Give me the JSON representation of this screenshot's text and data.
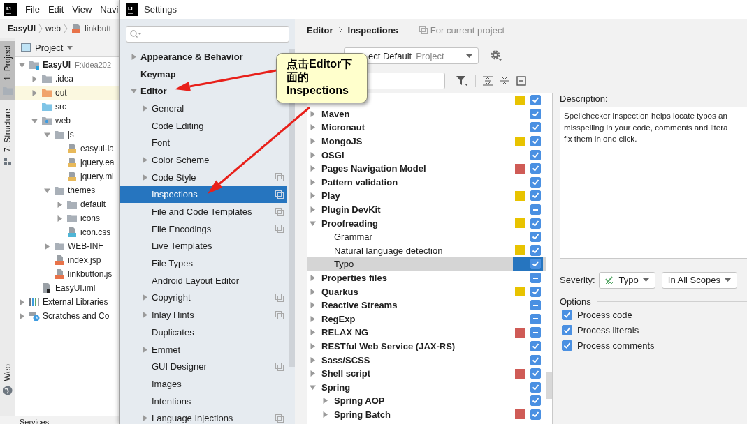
{
  "ide": {
    "logo_text": "IJ",
    "menu": [
      "File",
      "Edit",
      "View",
      "Navi"
    ],
    "breadcrumb": [
      {
        "label": "EasyUI",
        "kind": "project"
      },
      {
        "label": "web",
        "kind": "folder"
      },
      {
        "label": "linkbutt",
        "kind": "jsp"
      }
    ],
    "tool_strip": [
      {
        "label": "1: Project",
        "kind": "folder",
        "selected": true
      },
      {
        "label": "7: Structure",
        "kind": "structure",
        "selected": false
      }
    ],
    "tool_strip_bottom": [
      {
        "label": "Web",
        "kind": "globe"
      }
    ],
    "project_panel": {
      "title": "Project",
      "tree": [
        {
          "label": "EasyUI",
          "note": "F:\\idea202",
          "kind": "module",
          "expanded": true,
          "selected": false,
          "children": [
            {
              "label": ".idea",
              "kind": "folder",
              "expanded": false,
              "selected": false
            },
            {
              "label": "out",
              "kind": "excluded",
              "expanded": false,
              "selected": true
            },
            {
              "label": "src",
              "kind": "source",
              "selected": false
            },
            {
              "label": "web",
              "kind": "web",
              "expanded": true,
              "selected": false,
              "children": [
                {
                  "label": "js",
                  "kind": "folder",
                  "expanded": true,
                  "selected": false,
                  "children": [
                    {
                      "label": "easyui-la",
                      "kind": "js",
                      "selected": false
                    },
                    {
                      "label": "jquery.ea",
                      "kind": "minjs",
                      "selected": false
                    },
                    {
                      "label": "jquery.mi",
                      "kind": "minjs",
                      "selected": false
                    }
                  ]
                },
                {
                  "label": "themes",
                  "kind": "folder",
                  "expanded": true,
                  "selected": false,
                  "children": [
                    {
                      "label": "default",
                      "kind": "folder",
                      "expanded": false,
                      "selected": false
                    },
                    {
                      "label": "icons",
                      "kind": "folder",
                      "expanded": false,
                      "selected": false
                    },
                    {
                      "label": "icon.css",
                      "kind": "css",
                      "selected": false
                    }
                  ]
                },
                {
                  "label": "WEB-INF",
                  "kind": "folder",
                  "expanded": false,
                  "selected": false
                },
                {
                  "label": "index.jsp",
                  "kind": "jsp",
                  "selected": false
                },
                {
                  "label": "linkbutton.js",
                  "kind": "jsp",
                  "selected": false
                }
              ]
            },
            {
              "label": "EasyUI.iml",
              "kind": "iml",
              "selected": false
            }
          ]
        },
        {
          "label": "External Libraries",
          "kind": "libs",
          "expanded": false,
          "selected": false
        },
        {
          "label": "Scratches and Co",
          "kind": "scratches",
          "expanded": false,
          "selected": false
        }
      ]
    },
    "bottom_tab": "Services"
  },
  "settings": {
    "logo_text": "IJ",
    "title": "Settings",
    "nav": [
      {
        "label": "Appearance & Behavior",
        "expanded": false,
        "selected": false,
        "project_scope": false
      },
      {
        "label": "Keymap",
        "selected": false,
        "project_scope": false
      },
      {
        "label": "Editor",
        "expanded": true,
        "selected": false,
        "project_scope": false,
        "children": [
          {
            "label": "General",
            "expanded": false,
            "selected": false,
            "project_scope": false
          },
          {
            "label": "Code Editing",
            "selected": false,
            "project_scope": false
          },
          {
            "label": "Font",
            "selected": false,
            "project_scope": false
          },
          {
            "label": "Color Scheme",
            "expanded": false,
            "selected": false,
            "project_scope": false
          },
          {
            "label": "Code Style",
            "expanded": false,
            "selected": false,
            "project_scope": true
          },
          {
            "label": "Inspections",
            "selected": true,
            "project_scope": true
          },
          {
            "label": "File and Code Templates",
            "selected": false,
            "project_scope": true
          },
          {
            "label": "File Encodings",
            "selected": false,
            "project_scope": true
          },
          {
            "label": "Live Templates",
            "selected": false,
            "project_scope": false
          },
          {
            "label": "File Types",
            "selected": false,
            "project_scope": false
          },
          {
            "label": "Android Layout Editor",
            "selected": false,
            "project_scope": false
          },
          {
            "label": "Copyright",
            "expanded": false,
            "selected": false,
            "project_scope": true
          },
          {
            "label": "Inlay Hints",
            "expanded": false,
            "selected": false,
            "project_scope": true
          },
          {
            "label": "Duplicates",
            "selected": false,
            "project_scope": false
          },
          {
            "label": "Emmet",
            "expanded": false,
            "selected": false,
            "project_scope": false
          },
          {
            "label": "GUI Designer",
            "selected": false,
            "project_scope": true
          },
          {
            "label": "Images",
            "selected": false,
            "project_scope": false
          },
          {
            "label": "Intentions",
            "selected": false,
            "project_scope": false
          },
          {
            "label": "Language Injections",
            "expanded": false,
            "selected": false,
            "project_scope": true
          }
        ]
      }
    ],
    "breadcrumb": [
      "Editor",
      "Inspections"
    ],
    "scope_note": "For current project",
    "profile": {
      "value": "ect Default",
      "scope": "Project"
    },
    "inspections": [
      {
        "color": "#e8c300",
        "checked": true,
        "selected": false
      },
      {
        "name": "Maven",
        "expanded": false,
        "checked": true,
        "selected": false
      },
      {
        "name": "Micronaut",
        "expanded": false,
        "checked": true,
        "selected": false
      },
      {
        "name": "MongoJS",
        "expanded": false,
        "color": "#e8c300",
        "checked": true,
        "selected": false
      },
      {
        "name": "OSGi",
        "expanded": false,
        "checked": true,
        "selected": false
      },
      {
        "name": "Pages Navigation Model",
        "expanded": false,
        "color": "#cf5b56",
        "checked": true,
        "selected": false
      },
      {
        "name": "Pattern validation",
        "expanded": false,
        "checked": true,
        "selected": false
      },
      {
        "name": "Play",
        "expanded": false,
        "color": "#e8c300",
        "checked": true,
        "selected": false
      },
      {
        "name": "Plugin DevKit",
        "expanded": false,
        "partial": true,
        "selected": false
      },
      {
        "name": "Proofreading",
        "expanded": true,
        "color": "#e8c300",
        "checked": true,
        "selected": false,
        "children": [
          {
            "name": "Grammar",
            "checked": true,
            "selected": false
          },
          {
            "name": "Natural language detection",
            "color": "#e8c300",
            "checked": true,
            "selected": false
          },
          {
            "name": "Typo",
            "checked": true,
            "selected": true
          }
        ]
      },
      {
        "name": "Properties files",
        "expanded": false,
        "partial": true,
        "selected": false
      },
      {
        "name": "Quarkus",
        "expanded": false,
        "color": "#e8c300",
        "checked": true,
        "selected": false
      },
      {
        "name": "Reactive Streams",
        "expanded": false,
        "partial": true,
        "selected": false
      },
      {
        "name": "RegExp",
        "expanded": false,
        "partial": true,
        "selected": false
      },
      {
        "name": "RELAX NG",
        "expanded": false,
        "color": "#cf5b56",
        "partial": true,
        "selected": false
      },
      {
        "name": "RESTful Web Service (JAX-RS)",
        "expanded": false,
        "checked": true,
        "selected": false
      },
      {
        "name": "Sass/SCSS",
        "expanded": false,
        "checked": true,
        "selected": false
      },
      {
        "name": "Shell script",
        "expanded": false,
        "color": "#cf5b56",
        "checked": true,
        "selected": false
      },
      {
        "name": "Spring",
        "expanded": true,
        "checked": true,
        "selected": false,
        "children": [
          {
            "name": "Spring AOP",
            "expanded": false,
            "checked": true,
            "selected": false
          },
          {
            "name": "Spring Batch",
            "expanded": false,
            "color": "#cf5b56",
            "checked": true,
            "selected": false
          }
        ]
      }
    ],
    "description": {
      "label": "Description:",
      "lines": [
        "Spellchecker inspection helps locate typos an",
        "misspelling in your code, comments and litera",
        "fix them in one click."
      ]
    },
    "severity": {
      "label": "Severity:",
      "value": "Typo",
      "scope": "In All Scopes"
    },
    "options": {
      "title": "Options",
      "items": [
        {
          "label": "Process code",
          "checked": true
        },
        {
          "label": "Process literals",
          "checked": true
        },
        {
          "label": "Process comments",
          "checked": true
        }
      ]
    }
  },
  "callout": {
    "text": "点击Editor下面的Inspections"
  }
}
